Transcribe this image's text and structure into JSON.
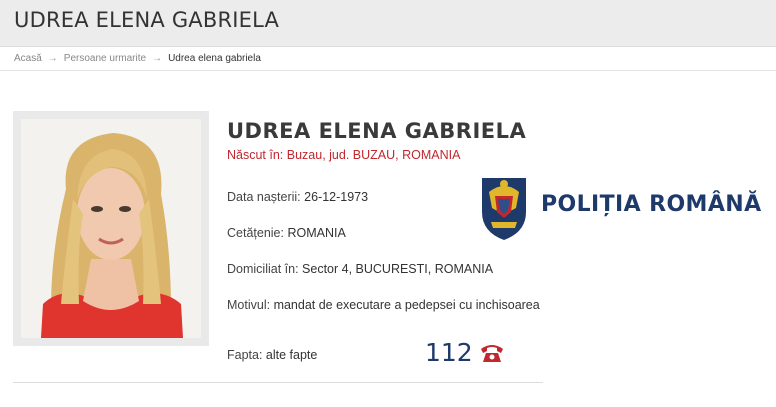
{
  "header": {
    "title": "UDREA ELENA GABRIELA"
  },
  "breadcrumb": {
    "items": [
      "Acasă",
      "Persoane urmarite",
      "Udrea elena gabriela"
    ],
    "separator": "→"
  },
  "profile": {
    "name": "UDREA ELENA GABRIELA",
    "birthplace": "Născut în: Buzau, jud. BUZAU, ROMANIA",
    "dob": {
      "label": "Data nașterii:",
      "value": "26-12-1973"
    },
    "citizenship": {
      "label": "Cetățenie:",
      "value": "ROMANIA"
    },
    "domicile": {
      "label": "Domiciliat în:",
      "value": "Sector 4, BUCURESTI, ROMANIA"
    },
    "motive": {
      "label": "Motivul:",
      "value": "mandat de executare a pedepsei cu inchisoarea"
    },
    "deed": {
      "label": "Fapta:",
      "value": "alte fapte"
    }
  },
  "emergency": {
    "number": "112",
    "icon": "phone-icon",
    "color": "#c1272d"
  },
  "logo": {
    "text": "POLIȚIA ROMÂNĂ",
    "icon": "coat-of-arms-icon",
    "color": "#1e3a6b"
  },
  "colors": {
    "accent_red": "#c1272d",
    "brand_blue": "#1e3a6b",
    "header_bg": "#ececec"
  }
}
